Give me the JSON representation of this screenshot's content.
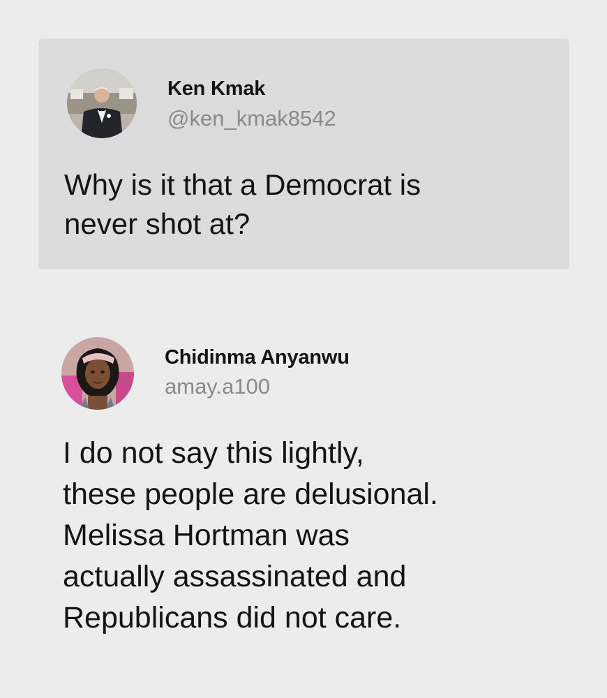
{
  "original_post": {
    "display_name": "Ken Kmak",
    "handle": "@ken_kmak8542",
    "text": "Why is it that a Democrat is\nnever shot at?"
  },
  "reply": {
    "display_name": "Chidinma Anyanwu",
    "handle": "amay.a100",
    "text": "I do not say this lightly,\nthese people are delusional.\nMelissa Hortman was\nactually assassinated and\nRepublicans did not care."
  },
  "colors": {
    "background": "#ececec",
    "card_background": "#dcdcdc",
    "text_primary": "#141414",
    "text_secondary": "#8a8a8a"
  }
}
